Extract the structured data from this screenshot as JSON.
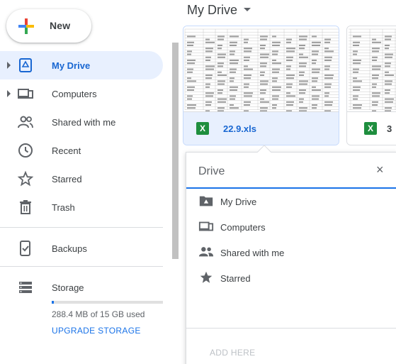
{
  "new_button": {
    "label": "New"
  },
  "nav": {
    "items": [
      {
        "label": "My Drive",
        "icon": "my-drive-icon",
        "active": true,
        "expandable": true
      },
      {
        "label": "Computers",
        "icon": "computers-icon",
        "active": false,
        "expandable": true
      },
      {
        "label": "Shared with me",
        "icon": "shared-icon",
        "active": false,
        "expandable": false
      },
      {
        "label": "Recent",
        "icon": "clock-icon",
        "active": false,
        "expandable": false
      },
      {
        "label": "Starred",
        "icon": "star-icon",
        "active": false,
        "expandable": false
      },
      {
        "label": "Trash",
        "icon": "trash-icon",
        "active": false,
        "expandable": false
      }
    ],
    "backups": {
      "label": "Backups",
      "icon": "backups-icon"
    },
    "storage": {
      "label": "Storage",
      "icon": "storage-icon",
      "used_text": "288.4 MB of 15 GB used",
      "used_fraction": 0.019,
      "upgrade_label": "UPGRADE STORAGE"
    }
  },
  "main": {
    "title": "My Drive",
    "files": [
      {
        "name": "22.9.xls",
        "type": "xls",
        "selected": true
      },
      {
        "name": "3",
        "type": "xls",
        "selected": false
      }
    ]
  },
  "popup": {
    "title": "Drive",
    "close_symbol": "×",
    "items": [
      {
        "label": "My Drive",
        "icon": "drive-folder-icon"
      },
      {
        "label": "Computers",
        "icon": "computers-icon"
      },
      {
        "label": "Shared with me",
        "icon": "shared-icon"
      },
      {
        "label": "Starred",
        "icon": "star-icon"
      }
    ],
    "add_here_label": "ADD HERE"
  },
  "colors": {
    "accent": "#1a73e8",
    "active_bg": "#e8f0fe",
    "excel_green": "#1e8e3e"
  }
}
